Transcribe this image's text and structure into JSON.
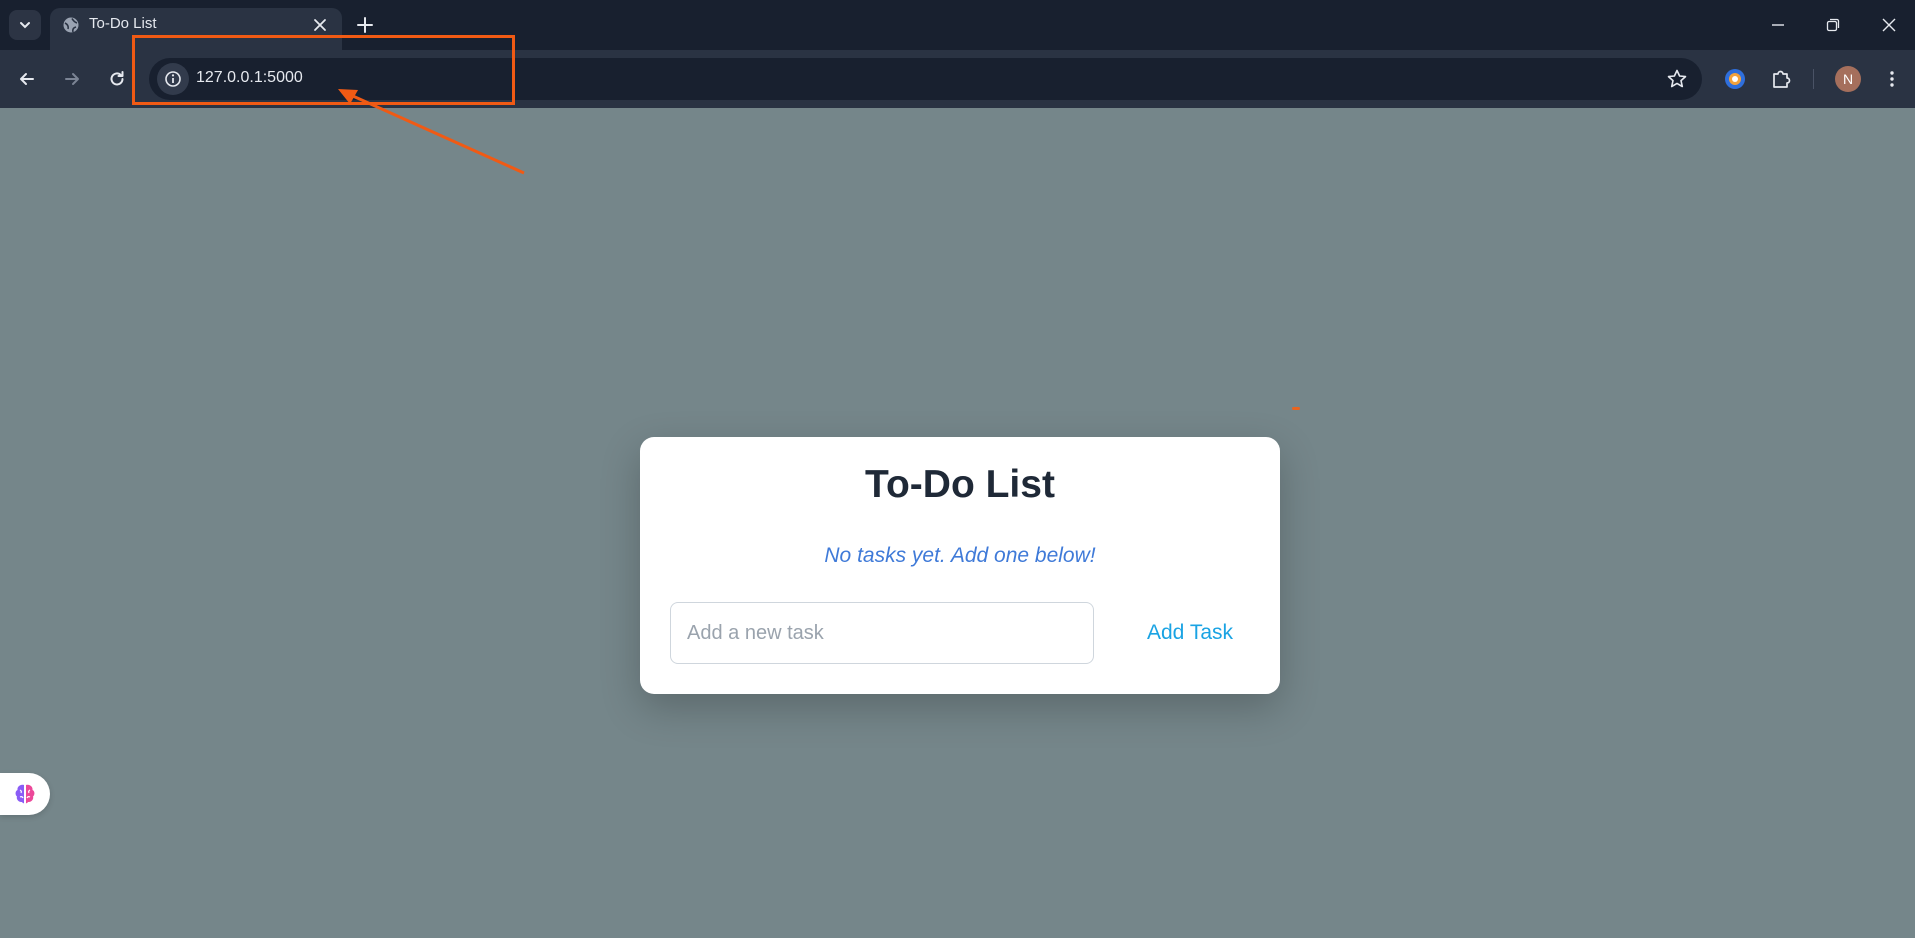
{
  "browser": {
    "tab_title": "To-Do List",
    "url": "127.0.0.1:5000",
    "profile_initial": "N"
  },
  "icons": {
    "tab_search": "chevron-down-icon",
    "favicon": "globe-icon",
    "tab_close": "close-icon",
    "new_tab": "plus-icon",
    "back": "arrow-left-icon",
    "forward": "arrow-right-icon",
    "reload": "reload-icon",
    "site_info": "info-icon",
    "bookmark": "star-icon",
    "extension_1": "extension-colorful-icon",
    "extensions": "puzzle-icon",
    "menu": "kebab-menu-icon",
    "minimize": "minimize-icon",
    "restore": "restore-icon",
    "close_window": "close-icon",
    "floating_widget": "brain-icon"
  },
  "app": {
    "title": "To-Do List",
    "empty_message": "No tasks yet. Add one below!",
    "input_placeholder": "Add a new task",
    "input_value": "",
    "add_button_label": "Add Task"
  },
  "colors": {
    "page_background": "#75868a",
    "annotation": "#f05a14",
    "empty_message": "#3f7ad8",
    "add_button": "#1aa3e3"
  }
}
